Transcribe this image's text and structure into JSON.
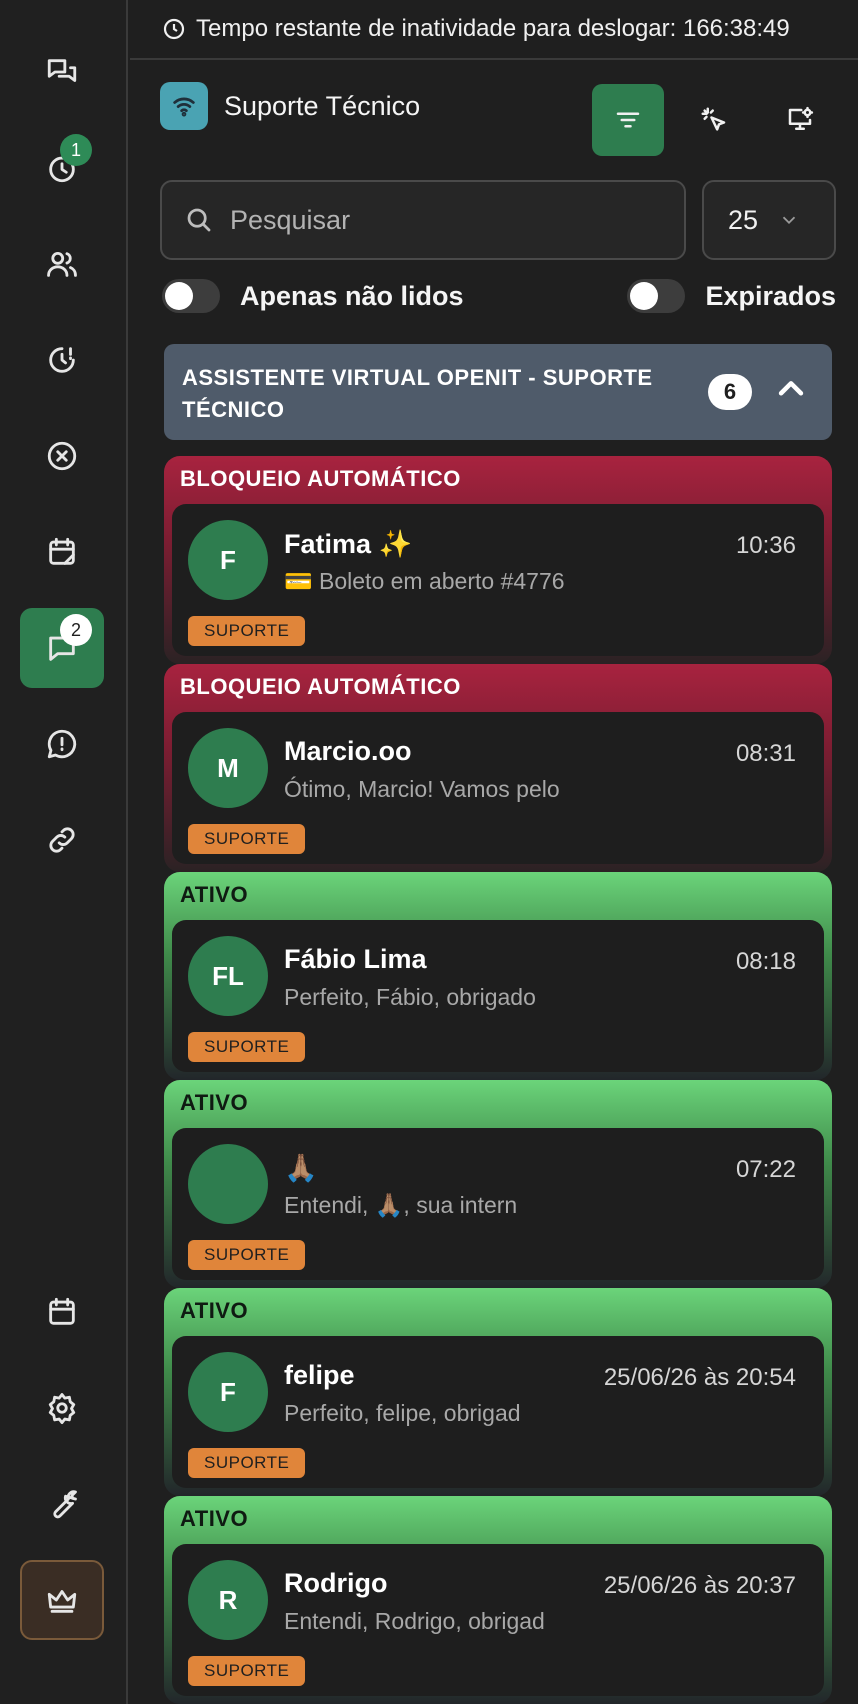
{
  "session": {
    "timer_text": "Tempo restante de inatividade para deslogar: 166:38:49"
  },
  "sidebar": {
    "items": [
      {
        "name": "chats-icon",
        "badge": ""
      },
      {
        "name": "history-icon",
        "badge": "1"
      },
      {
        "name": "contacts-icon",
        "badge": ""
      },
      {
        "name": "pending-clock-icon",
        "badge": ""
      },
      {
        "name": "closed-icon",
        "badge": ""
      },
      {
        "name": "calendar-note-icon",
        "badge": ""
      },
      {
        "name": "messages-icon",
        "badge": "2",
        "active": true
      },
      {
        "name": "alert-chat-icon",
        "badge": ""
      },
      {
        "name": "link-icon",
        "badge": ""
      },
      {
        "name": "calendar-icon",
        "badge": ""
      },
      {
        "name": "settings-icon",
        "badge": ""
      },
      {
        "name": "tools-icon",
        "badge": ""
      },
      {
        "name": "crown-icon",
        "badge": ""
      }
    ]
  },
  "header": {
    "title": "Suporte Técnico"
  },
  "search": {
    "placeholder": "Pesquisar",
    "page_size": "25"
  },
  "filters": {
    "unread_label": "Apenas não lidos",
    "expired_label": "Expirados"
  },
  "group": {
    "title": "ASSISTENTE VIRTUAL OPENIT - SUPORTE TÉCNICO",
    "count": "6"
  },
  "chats": [
    {
      "status": "BLOQUEIO AUTOMÁTICO",
      "kind": "blocked",
      "initials": "F",
      "name": "Fatima ✨",
      "time": "10:36",
      "message": "💳 Boleto em aberto #4776",
      "tag": "SUPORTE"
    },
    {
      "status": "BLOQUEIO AUTOMÁTICO",
      "kind": "blocked",
      "initials": "M",
      "name": "Marcio.oo",
      "time": "08:31",
      "message": "Ótimo, Marcio! Vamos pelo",
      "tag": "SUPORTE"
    },
    {
      "status": "ATIVO",
      "kind": "active",
      "initials": "FL",
      "name": "Fábio Lima",
      "time": "08:18",
      "message": "Perfeito, Fábio, obrigado",
      "tag": "SUPORTE"
    },
    {
      "status": "ATIVO",
      "kind": "active",
      "initials": "",
      "name": "🙏🏽",
      "time": "07:22",
      "message": "Entendi, 🙏🏽, sua intern",
      "tag": "SUPORTE"
    },
    {
      "status": "ATIVO",
      "kind": "active",
      "initials": "F",
      "name": "felipe",
      "time": "25/06/26 às 20:54",
      "message": "Perfeito, felipe, obrigad",
      "tag": "SUPORTE"
    },
    {
      "status": "ATIVO",
      "kind": "active",
      "initials": "R",
      "name": "Rodrigo",
      "time": "25/06/26 às 20:37",
      "message": "Entendi, Rodrigo, obrigad",
      "tag": "SUPORTE"
    }
  ]
}
